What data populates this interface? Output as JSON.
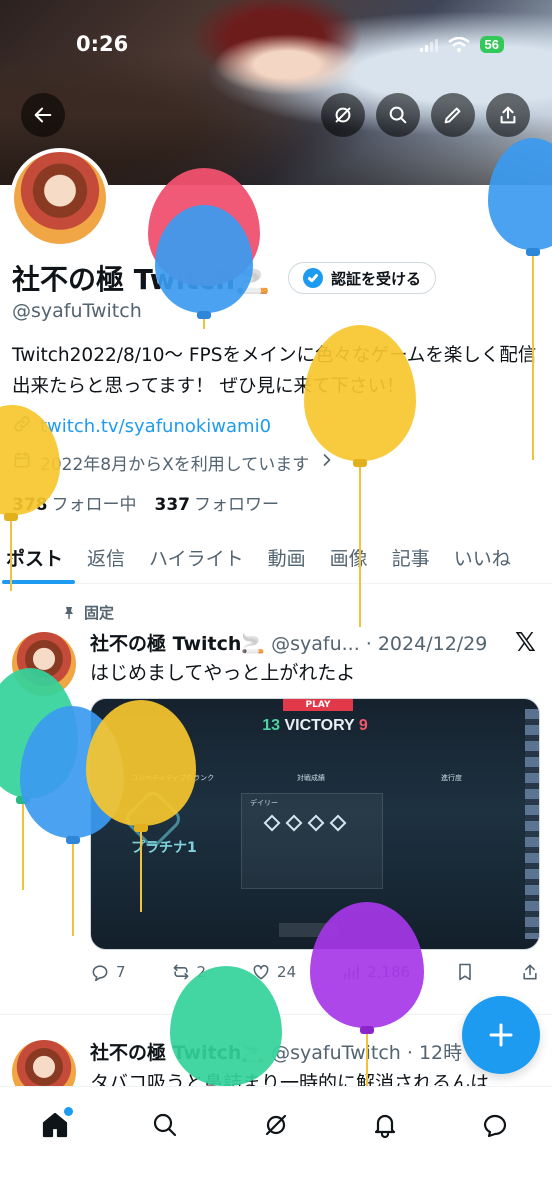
{
  "status_bar": {
    "time": "0:26",
    "battery": "56"
  },
  "header_buttons": {
    "back": "back-arrow",
    "grok": "grok-icon",
    "search": "search-icon",
    "edit": "pencil-icon",
    "share": "share-icon"
  },
  "profile": {
    "name": "社不の極 Twitch🚬",
    "handle": "@syafuTwitch",
    "verify_label": "認証を受ける",
    "bio": "Twitch2022/8/10～ FPSをメインに色々なゲームを楽しく配信出来たらと思ってます！ ぜひ見に来て下さい！",
    "link": "twitch.tv/syafunokiwami0",
    "joined": "2022年8月からXを利用しています",
    "following_count": "378",
    "following_label": "フォロー中",
    "followers_count": "337",
    "followers_label": "フォロワー"
  },
  "tabs": [
    "ポスト",
    "返信",
    "ハイライト",
    "動画",
    "画像",
    "記事",
    "いいね"
  ],
  "posts": [
    {
      "pinned_label": "固定",
      "name": "社不の極 Twitch🚬",
      "handle_date": "@syafu... · 2024/12/29",
      "text": "はじめましてやっと上がれたよ",
      "media": {
        "play": "PLAY",
        "score_left": "13",
        "result": "VICTORY",
        "score_right": "9",
        "rank": "プラチナ1",
        "col1": "コンペティティブのランク",
        "col2": "対戦成績",
        "col3": "進行度",
        "panel": "デイリー"
      },
      "replies": "7",
      "reposts": "2",
      "likes": "24",
      "views": "2,186"
    },
    {
      "name": "社不の極 Twitch🚬",
      "handle_date": "@syafuTwitch · 12時",
      "text": "タバコ吸うと鼻詰まり一時的に解消されるんは"
    }
  ],
  "nav": [
    "home-icon",
    "search-icon",
    "grok-icon",
    "bell-icon",
    "messages-icon"
  ],
  "colors": {
    "accent": "#1d9bf0",
    "text": "#0f1419",
    "muted": "#536471"
  }
}
